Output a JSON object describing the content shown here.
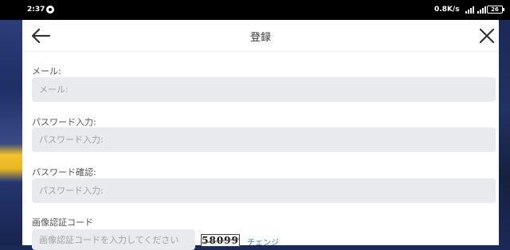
{
  "status_bar": {
    "time": "2:37",
    "speed": "0.8K/s",
    "battery": "26"
  },
  "header": {
    "title": "登録"
  },
  "form": {
    "email": {
      "label": "メール:",
      "placeholder": "メール:"
    },
    "password": {
      "label": "パスワード入力:",
      "placeholder": "パスワード入力:"
    },
    "password_confirm": {
      "label": "パスワード確認:",
      "placeholder": "パスワード入力:"
    },
    "captcha": {
      "label": "画像認証コード",
      "placeholder": "画像認証コードを入力してください",
      "image_text": "58099",
      "change_label": "チェンジ"
    }
  }
}
